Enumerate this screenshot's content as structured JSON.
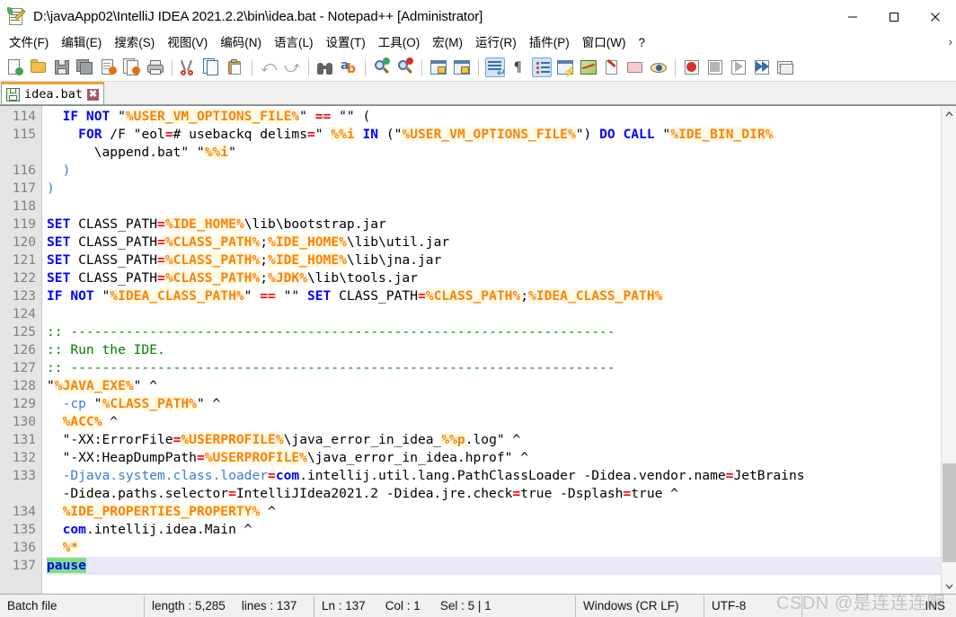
{
  "window": {
    "title": "D:\\javaApp02\\IntelliJ IDEA 2021.2.2\\bin\\idea.bat - Notepad++ [Administrator]",
    "app_icon": "notepad-plus-plus-icon",
    "controls": {
      "minimize": "minimize-icon",
      "maximize": "maximize-icon",
      "close": "close-icon"
    }
  },
  "menubar": {
    "items": [
      {
        "label": "文件(F)",
        "name": "menu-file"
      },
      {
        "label": "编辑(E)",
        "name": "menu-edit"
      },
      {
        "label": "搜索(S)",
        "name": "menu-search"
      },
      {
        "label": "视图(V)",
        "name": "menu-view"
      },
      {
        "label": "编码(N)",
        "name": "menu-encoding"
      },
      {
        "label": "语言(L)",
        "name": "menu-language"
      },
      {
        "label": "设置(T)",
        "name": "menu-settings"
      },
      {
        "label": "工具(O)",
        "name": "menu-tools"
      },
      {
        "label": "宏(M)",
        "name": "menu-macro"
      },
      {
        "label": "运行(R)",
        "name": "menu-run"
      },
      {
        "label": "插件(P)",
        "name": "menu-plugins"
      },
      {
        "label": "窗口(W)",
        "name": "menu-window"
      },
      {
        "label": "?",
        "name": "menu-help"
      }
    ],
    "overflow_chevron": "›"
  },
  "toolbar": {
    "buttons": [
      {
        "name": "new-file-icon"
      },
      {
        "name": "open-file-icon"
      },
      {
        "name": "save-icon"
      },
      {
        "name": "save-all-icon"
      },
      {
        "name": "close-file-icon"
      },
      {
        "name": "close-all-files-icon"
      },
      {
        "name": "print-icon"
      },
      {
        "sep": true
      },
      {
        "name": "cut-icon"
      },
      {
        "name": "copy-icon"
      },
      {
        "name": "paste-icon"
      },
      {
        "sep": true
      },
      {
        "name": "undo-icon"
      },
      {
        "name": "redo-icon"
      },
      {
        "sep": true
      },
      {
        "name": "find-icon"
      },
      {
        "name": "replace-icon"
      },
      {
        "sep": true
      },
      {
        "name": "zoom-in-icon"
      },
      {
        "name": "zoom-out-icon"
      },
      {
        "sep": true
      },
      {
        "name": "sync-vertical-scroll-icon"
      },
      {
        "name": "sync-horizontal-scroll-icon"
      },
      {
        "sep": true
      },
      {
        "name": "word-wrap-icon"
      },
      {
        "name": "show-all-characters-icon"
      },
      {
        "name": "indent-guide-icon"
      },
      {
        "name": "user-defined-language-icon"
      },
      {
        "name": "document-map-icon"
      },
      {
        "name": "function-list-icon"
      },
      {
        "name": "folder-as-workspace-icon"
      },
      {
        "name": "monitoring-icon"
      },
      {
        "sep": true
      },
      {
        "name": "start-recording-macro-icon"
      },
      {
        "name": "stop-recording-macro-icon"
      },
      {
        "name": "playback-macro-icon"
      },
      {
        "name": "run-macro-multiple-times-icon"
      },
      {
        "name": "save-current-macro-icon"
      }
    ]
  },
  "tabs": [
    {
      "label": "idea.bat",
      "modified": false,
      "active": true,
      "close_glyph": "✖"
    }
  ],
  "editor": {
    "first_line": 114,
    "lines": [
      {
        "n": "114",
        "tokens": [
          {
            "t": "  ",
            "c": "pl"
          },
          {
            "t": "IF NOT",
            "c": "k"
          },
          {
            "t": " \"",
            "c": "pl"
          },
          {
            "t": "%USER_VM_OPTIONS_FILE%",
            "c": "v"
          },
          {
            "t": "\" ",
            "c": "pl"
          },
          {
            "t": "==",
            "c": "op"
          },
          {
            "t": " \"\" (",
            "c": "pl"
          }
        ]
      },
      {
        "n": "115",
        "tokens": [
          {
            "t": "    ",
            "c": "pl"
          },
          {
            "t": "FOR",
            "c": "k"
          },
          {
            "t": " /F \"eol",
            "c": "pl"
          },
          {
            "t": "=",
            "c": "op"
          },
          {
            "t": "# usebackq delims",
            "c": "pl"
          },
          {
            "t": "=",
            "c": "op"
          },
          {
            "t": "\" ",
            "c": "pl"
          },
          {
            "t": "%%i",
            "c": "v"
          },
          {
            "t": " ",
            "c": "pl"
          },
          {
            "t": "IN",
            "c": "k"
          },
          {
            "t": " (\"",
            "c": "pl"
          },
          {
            "t": "%USER_VM_OPTIONS_FILE%",
            "c": "v"
          },
          {
            "t": "\") ",
            "c": "pl"
          },
          {
            "t": "DO CALL",
            "c": "k"
          },
          {
            "t": " \"",
            "c": "pl"
          },
          {
            "t": "%IDE_BIN_DIR%",
            "c": "v"
          }
        ]
      },
      {
        "n": "",
        "tokens": [
          {
            "t": "      \\append.bat\" \"",
            "c": "pl"
          },
          {
            "t": "%%i",
            "c": "v"
          },
          {
            "t": "\"",
            "c": "pl"
          }
        ]
      },
      {
        "n": "116",
        "tokens": [
          {
            "t": "  )",
            "c": "sw"
          }
        ]
      },
      {
        "n": "117",
        "tokens": [
          {
            "t": ")",
            "c": "sw"
          }
        ]
      },
      {
        "n": "118",
        "tokens": []
      },
      {
        "n": "119",
        "tokens": [
          {
            "t": "SET",
            "c": "k"
          },
          {
            "t": " CLASS_PATH",
            "c": "pl"
          },
          {
            "t": "=",
            "c": "op"
          },
          {
            "t": "%IDE_HOME%",
            "c": "v"
          },
          {
            "t": "\\lib\\bootstrap.jar",
            "c": "pl"
          }
        ]
      },
      {
        "n": "120",
        "tokens": [
          {
            "t": "SET",
            "c": "k"
          },
          {
            "t": " CLASS_PATH",
            "c": "pl"
          },
          {
            "t": "=",
            "c": "op"
          },
          {
            "t": "%CLASS_PATH%",
            "c": "v"
          },
          {
            "t": ";",
            "c": "pl"
          },
          {
            "t": "%IDE_HOME%",
            "c": "v"
          },
          {
            "t": "\\lib\\util.jar",
            "c": "pl"
          }
        ]
      },
      {
        "n": "121",
        "tokens": [
          {
            "t": "SET",
            "c": "k"
          },
          {
            "t": " CLASS_PATH",
            "c": "pl"
          },
          {
            "t": "=",
            "c": "op"
          },
          {
            "t": "%CLASS_PATH%",
            "c": "v"
          },
          {
            "t": ";",
            "c": "pl"
          },
          {
            "t": "%IDE_HOME%",
            "c": "v"
          },
          {
            "t": "\\lib\\jna.jar",
            "c": "pl"
          }
        ]
      },
      {
        "n": "122",
        "tokens": [
          {
            "t": "SET",
            "c": "k"
          },
          {
            "t": " CLASS_PATH",
            "c": "pl"
          },
          {
            "t": "=",
            "c": "op"
          },
          {
            "t": "%CLASS_PATH%",
            "c": "v"
          },
          {
            "t": ";",
            "c": "pl"
          },
          {
            "t": "%JDK%",
            "c": "v"
          },
          {
            "t": "\\lib\\tools.jar",
            "c": "pl"
          }
        ]
      },
      {
        "n": "123",
        "tokens": [
          {
            "t": "IF NOT",
            "c": "k"
          },
          {
            "t": " \"",
            "c": "pl"
          },
          {
            "t": "%IDEA_CLASS_PATH%",
            "c": "v"
          },
          {
            "t": "\" ",
            "c": "pl"
          },
          {
            "t": "==",
            "c": "op"
          },
          {
            "t": " \"\" ",
            "c": "pl"
          },
          {
            "t": "SET",
            "c": "k"
          },
          {
            "t": " CLASS_PATH",
            "c": "pl"
          },
          {
            "t": "=",
            "c": "op"
          },
          {
            "t": "%CLASS_PATH%",
            "c": "v"
          },
          {
            "t": ";",
            "c": "pl"
          },
          {
            "t": "%IDEA_CLASS_PATH%",
            "c": "v"
          }
        ]
      },
      {
        "n": "124",
        "tokens": []
      },
      {
        "n": "125",
        "tokens": [
          {
            "t": ":: ---------------------------------------------------------------------",
            "c": "cm"
          }
        ]
      },
      {
        "n": "126",
        "tokens": [
          {
            "t": ":: Run the IDE.",
            "c": "cm"
          }
        ]
      },
      {
        "n": "127",
        "tokens": [
          {
            "t": ":: ---------------------------------------------------------------------",
            "c": "cm"
          }
        ]
      },
      {
        "n": "128",
        "tokens": [
          {
            "t": "\"",
            "c": "pl"
          },
          {
            "t": "%JAVA_EXE%",
            "c": "v"
          },
          {
            "t": "\" ^",
            "c": "pl"
          }
        ]
      },
      {
        "n": "129",
        "tokens": [
          {
            "t": "  ",
            "c": "pl"
          },
          {
            "t": "-cp",
            "c": "sw"
          },
          {
            "t": " \"",
            "c": "pl"
          },
          {
            "t": "%CLASS_PATH%",
            "c": "v"
          },
          {
            "t": "\" ^",
            "c": "pl"
          }
        ]
      },
      {
        "n": "130",
        "tokens": [
          {
            "t": "  ",
            "c": "pl"
          },
          {
            "t": "%ACC%",
            "c": "v"
          },
          {
            "t": " ^",
            "c": "pl"
          }
        ]
      },
      {
        "n": "131",
        "tokens": [
          {
            "t": "  \"-XX:ErrorFile",
            "c": "pl"
          },
          {
            "t": "=",
            "c": "op"
          },
          {
            "t": "%USERPROFILE%",
            "c": "v"
          },
          {
            "t": "\\java_error_in_idea_",
            "c": "pl"
          },
          {
            "t": "%%p",
            "c": "v"
          },
          {
            "t": ".log\" ^",
            "c": "pl"
          }
        ]
      },
      {
        "n": "132",
        "tokens": [
          {
            "t": "  \"-XX:HeapDumpPath",
            "c": "pl"
          },
          {
            "t": "=",
            "c": "op"
          },
          {
            "t": "%USERPROFILE%",
            "c": "v"
          },
          {
            "t": "\\java_error_in_idea.hprof\" ^",
            "c": "pl"
          }
        ]
      },
      {
        "n": "133",
        "tokens": [
          {
            "t": "  ",
            "c": "pl"
          },
          {
            "t": "-Djava.system.class.loader",
            "c": "sw"
          },
          {
            "t": "=",
            "c": "op"
          },
          {
            "t": "com",
            "c": "k"
          },
          {
            "t": ".intellij.util.lang.PathClassLoader -Didea.vendor.name",
            "c": "pl"
          },
          {
            "t": "=",
            "c": "op"
          },
          {
            "t": "JetBrains",
            "c": "pl"
          }
        ]
      },
      {
        "n": "",
        "tokens": [
          {
            "t": "  -Didea.paths.selector",
            "c": "pl"
          },
          {
            "t": "=",
            "c": "op"
          },
          {
            "t": "IntelliJIdea2021.2 -Didea.jre.check",
            "c": "pl"
          },
          {
            "t": "=",
            "c": "op"
          },
          {
            "t": "true -Dsplash",
            "c": "pl"
          },
          {
            "t": "=",
            "c": "op"
          },
          {
            "t": "true ^",
            "c": "pl"
          }
        ]
      },
      {
        "n": "134",
        "tokens": [
          {
            "t": "  ",
            "c": "pl"
          },
          {
            "t": "%IDE_PROPERTIES_PROPERTY%",
            "c": "v"
          },
          {
            "t": " ^",
            "c": "pl"
          }
        ]
      },
      {
        "n": "135",
        "tokens": [
          {
            "t": "  ",
            "c": "pl"
          },
          {
            "t": "com",
            "c": "k"
          },
          {
            "t": ".intellij.idea.Main ^",
            "c": "pl"
          }
        ]
      },
      {
        "n": "136",
        "tokens": [
          {
            "t": "  ",
            "c": "pl"
          },
          {
            "t": "%*",
            "c": "v"
          }
        ]
      },
      {
        "n": "137",
        "current": true,
        "tokens": [
          {
            "t": "pause",
            "c": "k",
            "highlight": true
          }
        ]
      }
    ],
    "scrollbar": {
      "up_glyph": "⌃",
      "down_glyph": "⌄"
    }
  },
  "statusbar": {
    "file_type": "Batch file",
    "length_label": "length : 5,285",
    "lines_label": "lines : 137",
    "ln": "Ln : 137",
    "col": "Col : 1",
    "sel": "Sel : 5 | 1",
    "eol": "Windows (CR LF)",
    "encoding": "UTF-8",
    "insert_mode": "INS"
  },
  "watermark": "CSDN @是连连连啊",
  "colors": {
    "keyword": "#0000ff",
    "operator": "#ff0000",
    "variable": "#ff8000",
    "comment": "#008000",
    "switch": "#3a7ad9",
    "tab_accent": "#f0a030",
    "current_line": "#e8e8f8",
    "search_highlight": "#7fe07f",
    "gutter_bg": "#e4e4e4"
  }
}
